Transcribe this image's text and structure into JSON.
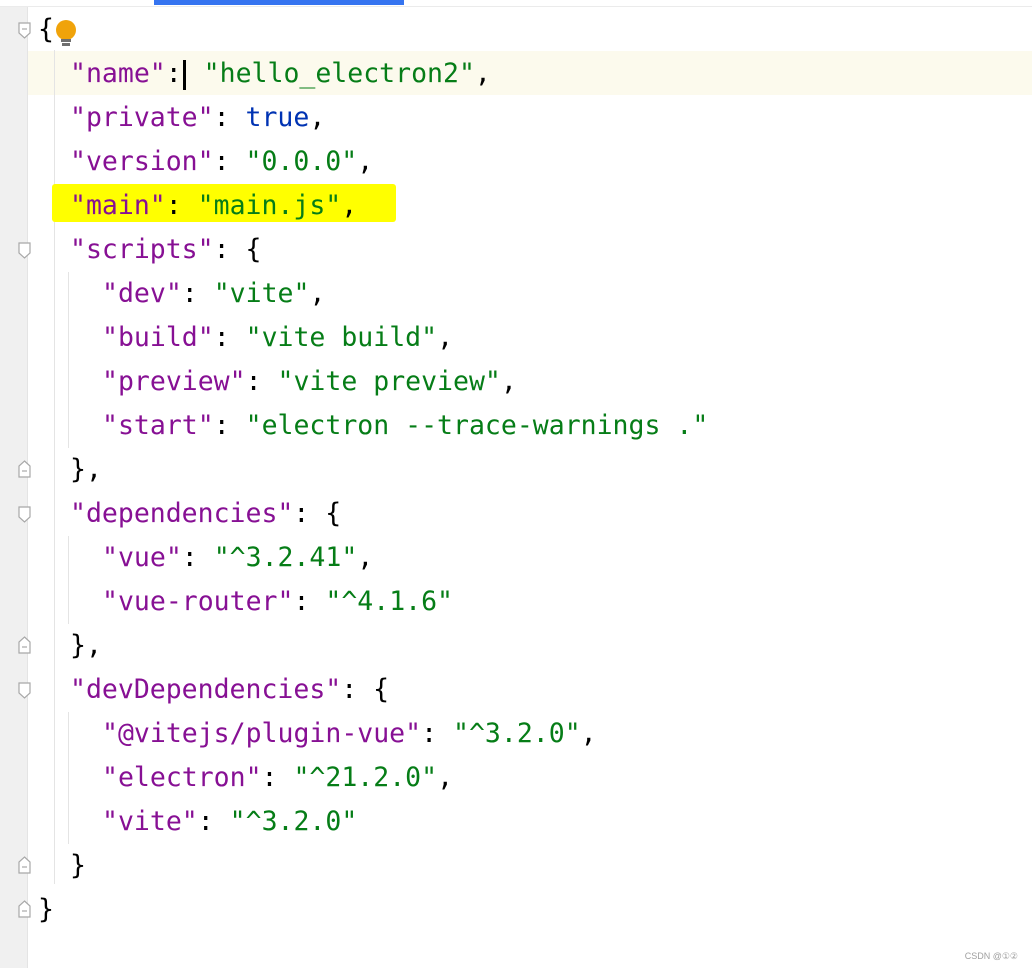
{
  "editor": {
    "lines": [
      {
        "open_brace": "{"
      },
      {
        "key": "\"name\"",
        "colon": ":",
        "value": "\"hello_electron2\"",
        "comma": ","
      },
      {
        "key": "\"private\"",
        "colon": ": ",
        "value": "true",
        "comma": ","
      },
      {
        "key": "\"version\"",
        "colon": ": ",
        "value": "\"0.0.0\"",
        "comma": ","
      },
      {
        "key": "\"main\"",
        "colon": ": ",
        "value": "\"main.js\"",
        "comma": ","
      },
      {
        "key": "\"scripts\"",
        "colon": ": ",
        "brace": "{"
      },
      {
        "key": "\"dev\"",
        "colon": ": ",
        "value": "\"vite\"",
        "comma": ","
      },
      {
        "key": "\"build\"",
        "colon": ": ",
        "value": "\"vite build\"",
        "comma": ","
      },
      {
        "key": "\"preview\"",
        "colon": ": ",
        "value": "\"vite preview\"",
        "comma": ","
      },
      {
        "key": "\"start\"",
        "colon": ": ",
        "value": "\"electron --trace-warnings .\""
      },
      {
        "close": "}",
        "comma": ","
      },
      {
        "key": "\"dependencies\"",
        "colon": ": ",
        "brace": "{"
      },
      {
        "key": "\"vue\"",
        "colon": ": ",
        "value": "\"^3.2.41\"",
        "comma": ","
      },
      {
        "key": "\"vue-router\"",
        "colon": ": ",
        "value": "\"^4.1.6\""
      },
      {
        "close": "}",
        "comma": ","
      },
      {
        "key": "\"devDependencies\"",
        "colon": ": ",
        "brace": "{"
      },
      {
        "key": "\"@vitejs/plugin-vue\"",
        "colon": ": ",
        "value": "\"^3.2.0\"",
        "comma": ","
      },
      {
        "key": "\"electron\"",
        "colon": ": ",
        "value": "\"^21.2.0\"",
        "comma": ","
      },
      {
        "key": "\"vite\"",
        "colon": ": ",
        "value": "\"^3.2.0\""
      },
      {
        "close": "}"
      },
      {
        "close": "}"
      }
    ]
  },
  "watermark": "CSDN @①②",
  "colors": {
    "key": "#871094",
    "string": "#067d17",
    "keyword": "#0033b3",
    "highlight": "#ffff00",
    "current_line": "#fcfaed",
    "gutter": "#f0f0f0",
    "tab_indicator": "#3574f0",
    "intention_bulb": "#f0a30a"
  },
  "icons": {
    "intention": "lightbulb-icon",
    "fold": "fold-marker-icon"
  }
}
